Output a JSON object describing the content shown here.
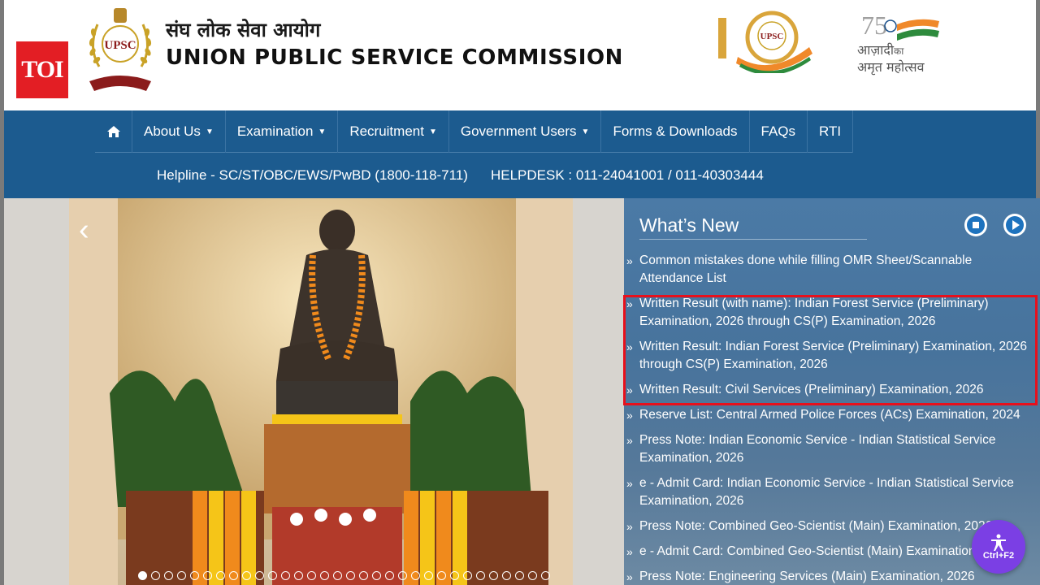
{
  "header": {
    "toi_badge": "TOI",
    "emblem_label": "UPSC",
    "title_hindi": "संघ लोक सेवा आयोग",
    "title_english": "UNION PUBLIC SERVICE COMMISSION",
    "logo_100_label": "UPSC",
    "azadi_line1": "आज़ादी",
    "azadi_line1b": "का",
    "azadi_line2": "अमृत महोत्सव",
    "azadi_number": "75"
  },
  "nav": {
    "menu": [
      {
        "label": "About Us",
        "dropdown": true
      },
      {
        "label": "Examination",
        "dropdown": true
      },
      {
        "label": "Recruitment",
        "dropdown": true
      },
      {
        "label": "Government Users",
        "dropdown": true
      },
      {
        "label": "Forms & Downloads",
        "dropdown": false
      },
      {
        "label": "FAQs",
        "dropdown": false
      },
      {
        "label": "RTI",
        "dropdown": false
      }
    ],
    "helpline": "Helpline - SC/ST/OBC/EWS/PwBD (1800-118-711)",
    "helpdesk": "HELPDESK : 011-24041001 / 011-40303444"
  },
  "slider": {
    "dot_count": 32,
    "active_dot": 0
  },
  "whats_new": {
    "title": "What’s New",
    "items": [
      "Common mistakes done while filling OMR Sheet/Scannable Attendance List",
      "Written Result (with name): Indian Forest Service (Preliminary) Examination, 2026 through CS(P) Examination, 2026",
      "Written Result: Indian Forest Service (Preliminary) Examination, 2026 through CS(P) Examination, 2026",
      "Written Result: Civil Services (Preliminary) Examination, 2026",
      "Reserve List: Central Armed Police Forces (ACs) Examination, 2024",
      "Press Note: Indian Economic Service - Indian Statistical Service Examination, 2026",
      "e - Admit Card: Indian Economic Service - Indian Statistical Service Examination, 2026",
      "Press Note: Combined Geo-Scientist (Main) Examination, 2026",
      "e - Admit Card: Combined Geo-Scientist (Main) Examination, 2026",
      "Press Note: Engineering Services (Main) Examination, 2026"
    ]
  },
  "accessibility": {
    "shortcut": "Ctrl+F2"
  },
  "colors": {
    "nav_bg": "#1c5b8f",
    "whats_new_bg": "#3f6d98",
    "highlight_border": "#e8101c",
    "toi_red": "#e31e24",
    "a11y_purple": "#7b3fe4"
  }
}
